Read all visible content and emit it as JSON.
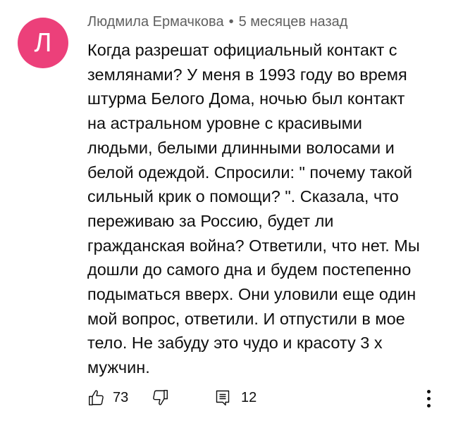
{
  "comment": {
    "avatar_letter": "Л",
    "avatar_color": "#ec407a",
    "author": "Людмила Ермачкова",
    "separator": "•",
    "timestamp": "5 месяцев назад",
    "text": "Когда разрешат официальный контакт с землянами? У меня в 1993 году во время штурма Белого Дома, ночью был контакт на астральном уровне с красивыми людьми, белыми длинными волосами и белой одеждой. Спросили: \" почему такой сильный крик о помощи? \". Сказала, что переживаю за Россию, будет ли гражданская война? Ответили, что нет. Мы дошли до самого дна и будем постепенно подыматься вверх. Они уловили еще один мой вопрос, ответили. И отпустили в мое тело. Не забуду это чудо и красоту 3 х мужчин.",
    "likes": "73",
    "replies": "12",
    "icons": {
      "like": "thumbs-up-icon",
      "dislike": "thumbs-down-icon",
      "reply": "reply-comment-icon",
      "more": "more-vertical-icon"
    }
  }
}
